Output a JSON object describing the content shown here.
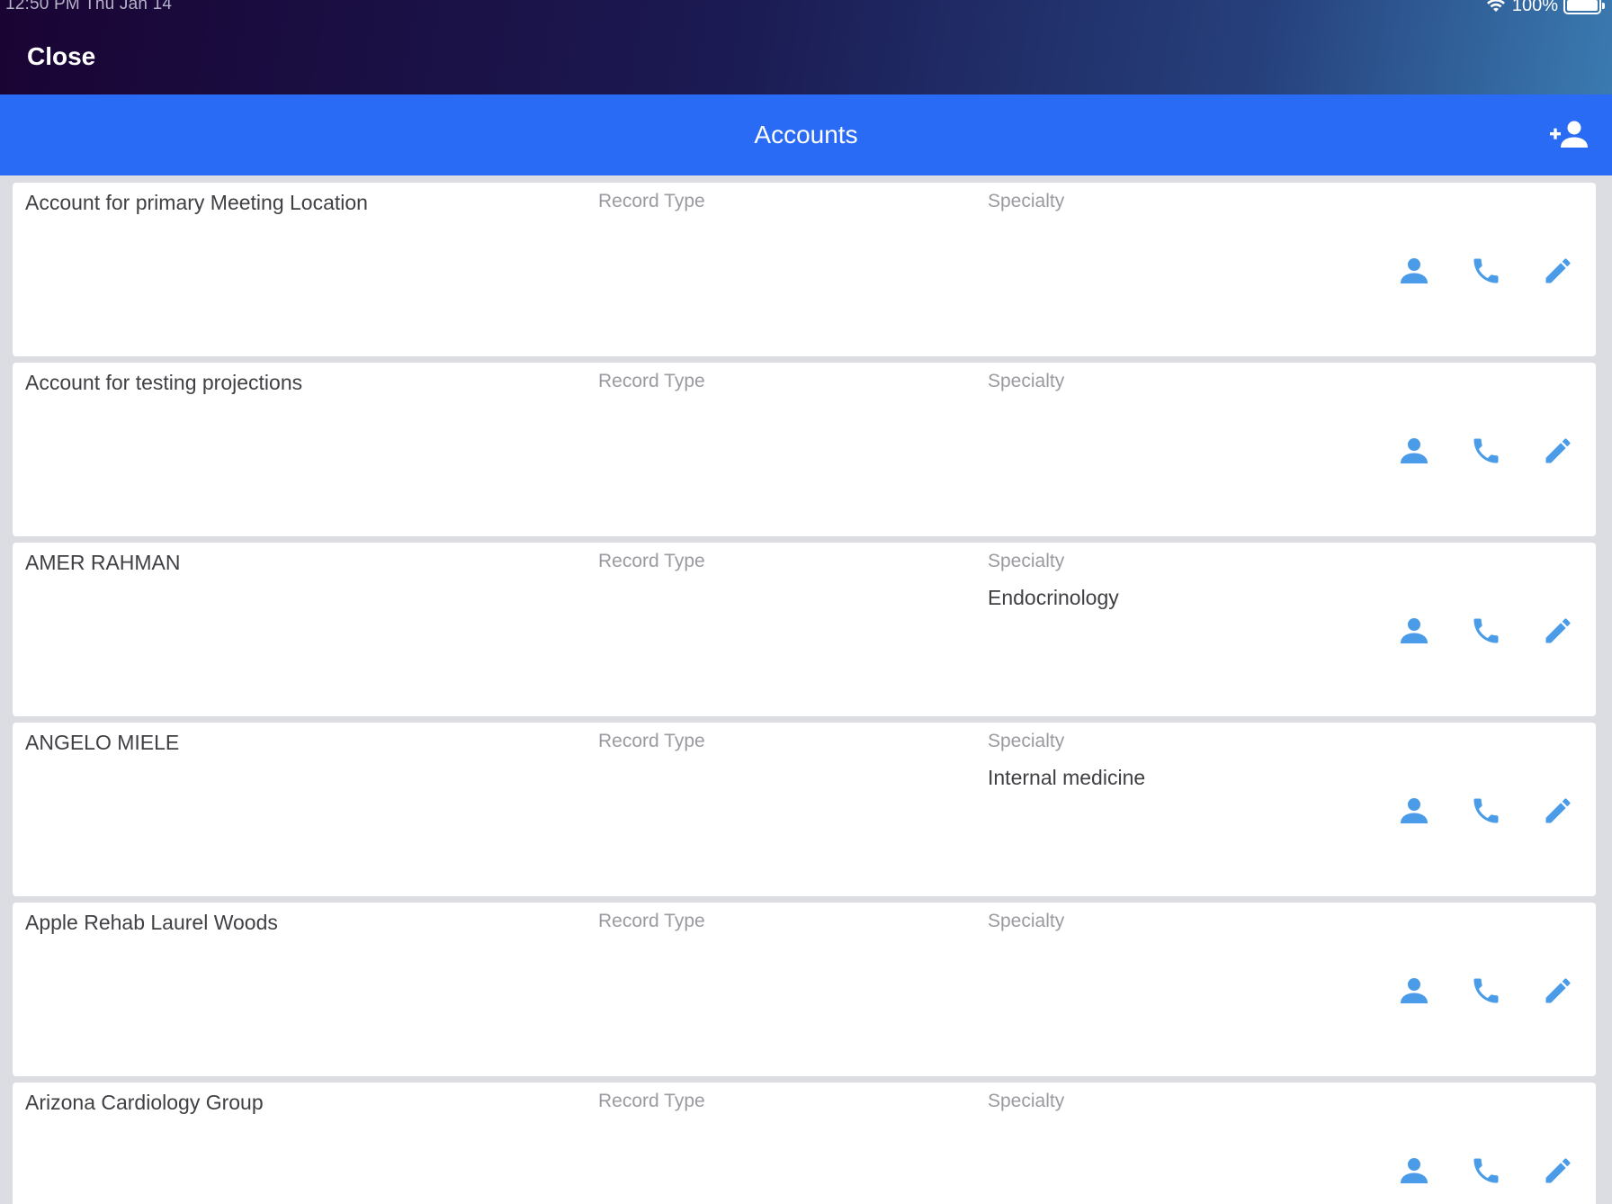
{
  "status_bar": {
    "time": "12:50 PM   Thu Jan 14",
    "battery": "100%"
  },
  "nav": {
    "close_label": "Close"
  },
  "header": {
    "title": "Accounts",
    "add_icon": "add-person-icon"
  },
  "accent_colors": {
    "header": "#2a6bf5",
    "icons": "#4a9be8"
  },
  "accounts": [
    {
      "name": "Account for primary Meeting Location",
      "record_type_label": "Record Type",
      "specialty_label": "Specialty",
      "specialty": ""
    },
    {
      "name": "Account for testing projections",
      "record_type_label": "Record Type",
      "specialty_label": "Specialty",
      "specialty": ""
    },
    {
      "name": "AMER RAHMAN",
      "record_type_label": "Record Type",
      "specialty_label": "Specialty",
      "specialty": "Endocrinology"
    },
    {
      "name": "ANGELO MIELE",
      "record_type_label": "Record Type",
      "specialty_label": "Specialty",
      "specialty": "Internal medicine"
    },
    {
      "name": "Apple Rehab Laurel Woods",
      "record_type_label": "Record Type",
      "specialty_label": "Specialty",
      "specialty": ""
    },
    {
      "name": "Arizona Cardiology Group",
      "record_type_label": "Record Type",
      "specialty_label": "Specialty",
      "specialty": ""
    }
  ],
  "row_actions": [
    "person-icon",
    "phone-icon",
    "edit-pencil-icon"
  ]
}
